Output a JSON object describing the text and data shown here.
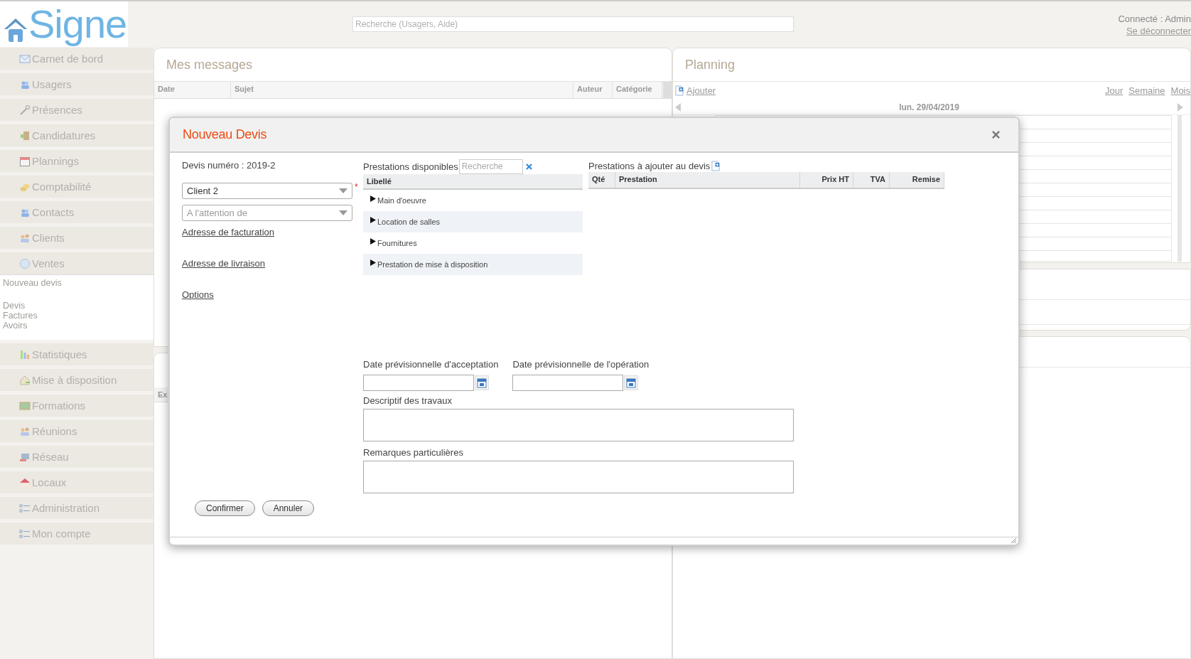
{
  "header": {
    "logo": "Signe",
    "search_placeholder": "Recherche (Usagers, Aide)",
    "user": "Connecté : Admin",
    "logout": "Se déconnecter"
  },
  "sidebar": {
    "items": [
      {
        "label": "Carnet de bord"
      },
      {
        "label": "Usagers"
      },
      {
        "label": "Présences"
      },
      {
        "label": "Candidatures"
      },
      {
        "label": "Plannings"
      },
      {
        "label": "Comptabilité"
      },
      {
        "label": "Contacts"
      },
      {
        "label": "Clients"
      },
      {
        "label": "Ventes",
        "children": [
          [
            "Nouveau devis"
          ],
          [
            "Devis",
            "Factures",
            "Avoirs"
          ]
        ]
      },
      {
        "label": "Statistiques"
      },
      {
        "label": "Mise à disposition"
      },
      {
        "label": "Formations"
      },
      {
        "label": "Réunions"
      },
      {
        "label": "Réseau"
      },
      {
        "label": "Locaux"
      },
      {
        "label": "Administration"
      },
      {
        "label": "Mon compte"
      }
    ]
  },
  "messages_panel": {
    "title": "Mes messages",
    "columns": [
      "Date",
      "Sujet",
      "Auteur",
      "Catégorie"
    ]
  },
  "lower_left_panel": {
    "columns": [
      "Ex"
    ]
  },
  "planning_panel": {
    "title": "Planning",
    "add_link": "Ajouter",
    "views": [
      "Jour",
      "Semaine",
      "Mois"
    ],
    "date": "lun. 29/04/2019"
  },
  "modal": {
    "title": "Nouveau Devis",
    "quote_number": "Devis numéro : 2019-2",
    "client_select": {
      "value": "Client 2",
      "required_mark": "*"
    },
    "attention_select": {
      "placeholder": "A l'attention de"
    },
    "links": [
      "Adresse de facturation",
      "Adresse de livraison",
      "Options"
    ],
    "available": {
      "label": "Prestations disponibles",
      "search_placeholder": "Recherche",
      "column": "Libellé",
      "rows": [
        {
          "label": "Main d'oeuvre",
          "expanded": false
        },
        {
          "label": "Location de salles",
          "expanded": false
        },
        {
          "label": "Fournitures",
          "expanded": false
        },
        {
          "label": "Prestation de mise à disposition",
          "expanded": false
        }
      ]
    },
    "to_add": {
      "label": "Prestations à ajouter au devis",
      "columns": [
        "Qté",
        "Prestation",
        "Prix HT",
        "TVA",
        "Remise"
      ]
    },
    "dates": [
      {
        "label": "Date prévisionnelle d'acceptation"
      },
      {
        "label": "Date prévisionnelle de l'opération"
      }
    ],
    "description": {
      "label": "Descriptif des travaux"
    },
    "remarks": {
      "label": "Remarques particulières"
    },
    "buttons": [
      "Confirmer",
      "Annuler"
    ]
  }
}
